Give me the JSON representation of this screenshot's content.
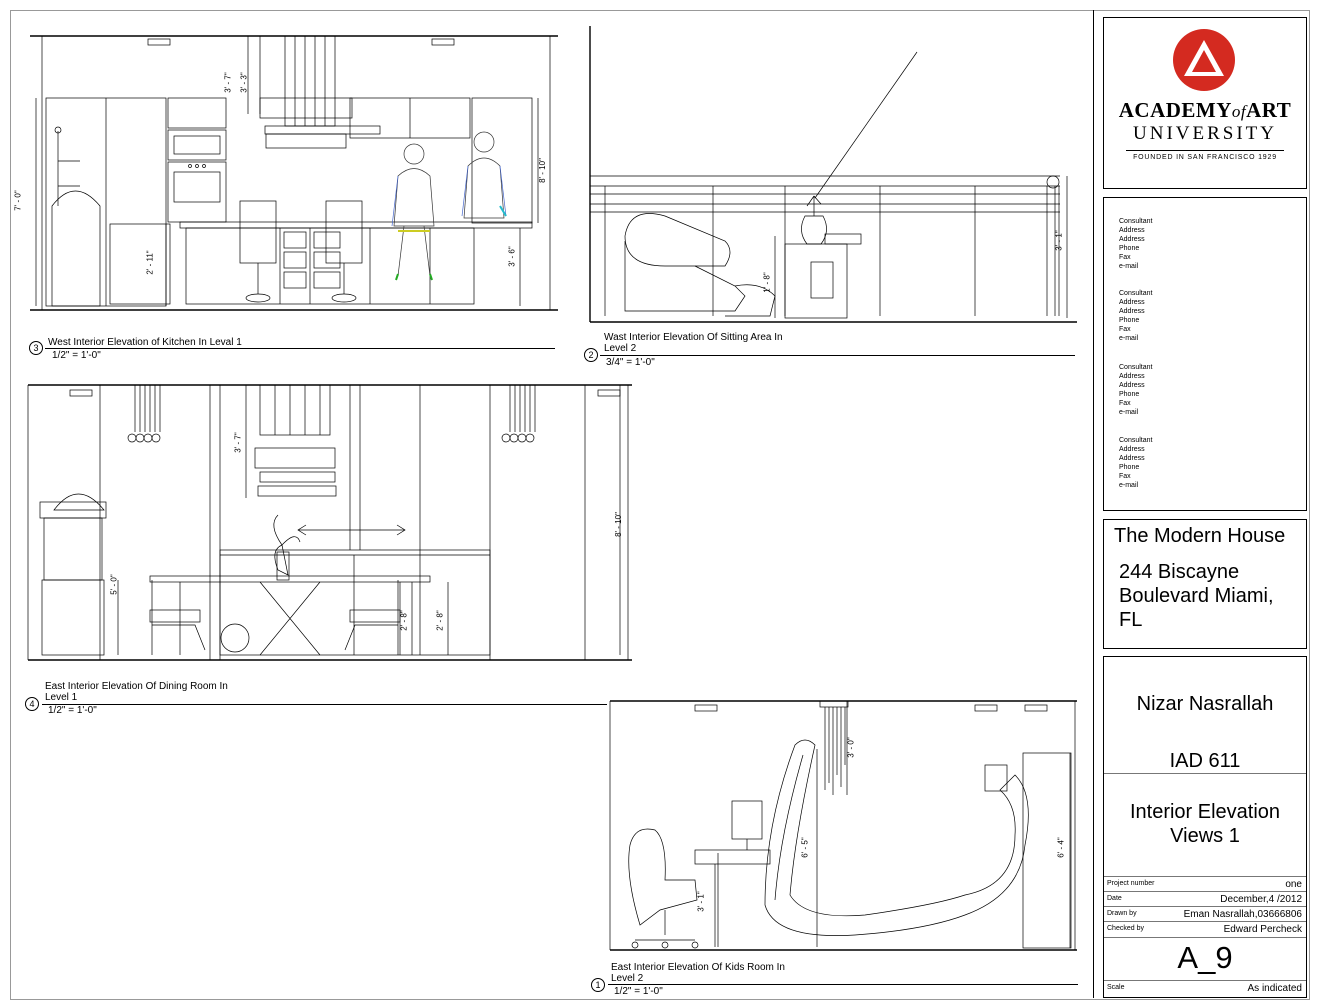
{
  "views": [
    {
      "number": "3",
      "title": "West Interior Elevation of  Kitchen In Leval 1",
      "scale": "1/2\" = 1'-0\""
    },
    {
      "number": "2",
      "title_lines": [
        "Wast Interior Elevation Of Sitting Area In",
        "Level 2"
      ],
      "scale": "3/4\" = 1'-0\""
    },
    {
      "number": "4",
      "title_lines": [
        "East Interior Elevation Of Dining Room In",
        "Level 1"
      ],
      "scale": "1/2\" = 1'-0\""
    },
    {
      "number": "1",
      "title_lines": [
        "East Interior Elevation Of Kids Room In",
        "Level 2"
      ],
      "scale": "1/2\" = 1'-0\""
    }
  ],
  "dimensions": {
    "kitchen": [
      "7' - 0\"",
      "3' - 7\"",
      "3' - 3\"",
      "8' - 10\"",
      "2' - 11\"",
      "3' - 6\""
    ],
    "sitting": [
      "3' - 1\"",
      "1' - 8\""
    ],
    "dining": [
      "3' - 7\"",
      "8' - 10\"",
      "5' - 0\"",
      "2' - 8\"",
      "2' - 8\""
    ],
    "kids": [
      "3' - 0\"",
      "6' - 5\"",
      "6' - 4\"",
      "3' - 1\""
    ]
  },
  "title_block": {
    "logo": {
      "line1a": "ACADEMY",
      "line1b": "of",
      "line1c": "ART",
      "line2": "UNIVERSITY",
      "line3": "FOUNDED IN SAN FRANCISCO 1929",
      "color": "#d42a20"
    },
    "consultants": [
      [
        "Consultant",
        "Address",
        "Address",
        "Phone",
        "Fax",
        "e-mail"
      ],
      [
        "Consultant",
        "Address",
        "Address",
        "Phone",
        "Fax",
        "e-mail"
      ],
      [
        "Consultant",
        "Address",
        "Address",
        "Phone",
        "Fax",
        "e-mail"
      ],
      [
        "Consultant",
        "Address",
        "Address",
        "Phone",
        "Fax",
        "e-mail"
      ]
    ],
    "project_name": "The Modern House",
    "address_lines": [
      "244 Biscayne",
      "Boulevard Miami,",
      "FL"
    ],
    "author": "Nizar Nasrallah",
    "course": "IAD 611",
    "sheet_title_lines": [
      "Interior Elevation",
      "Views 1"
    ],
    "rows": [
      {
        "key": "Project number",
        "value": "one"
      },
      {
        "key": "Date",
        "value": "December,4 /2012"
      },
      {
        "key": "Drawn by",
        "value": "Eman Nasrallah,03666806"
      },
      {
        "key": "Checked by",
        "value": "Edward Percheck"
      }
    ],
    "sheet_number": "A_9",
    "scale_key": "Scale",
    "scale_value": "As indicated"
  }
}
